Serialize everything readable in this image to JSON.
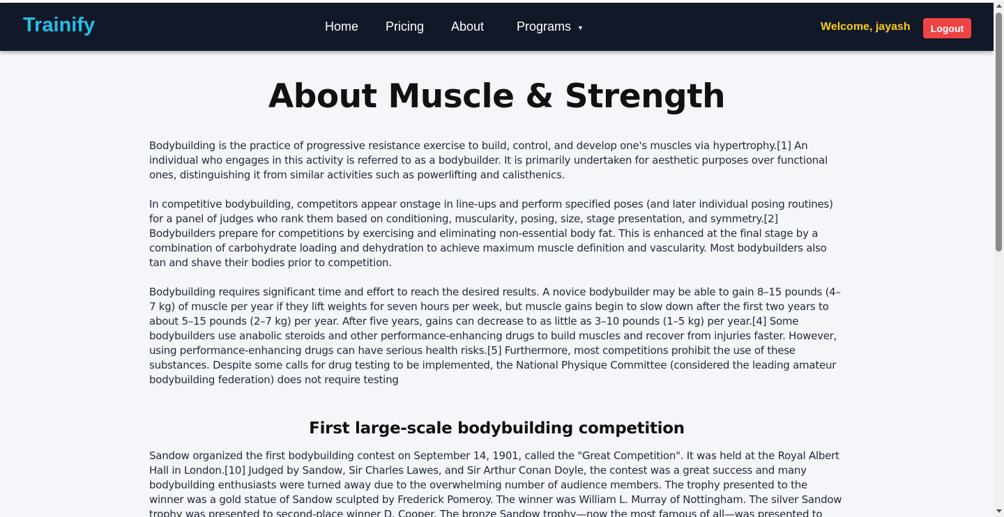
{
  "navbar": {
    "brand": "Trainify",
    "links": {
      "home": "Home",
      "pricing": "Pricing",
      "about": "About",
      "programs": "Programs"
    },
    "welcome": "Welcome, jayash",
    "logout_label": "Logout",
    "colors": {
      "background": "#111827",
      "brand": "#22c0e8",
      "welcome": "#facc15",
      "logout": "#ef4444"
    }
  },
  "page": {
    "title": "About Muscle & Strength",
    "paragraphs": [
      "Bodybuilding is the practice of progressive resistance exercise to build, control, and develop one's muscles via hypertrophy.[1] An individual who engages in this activity is referred to as a bodybuilder. It is primarily undertaken for aesthetic purposes over functional ones, distinguishing it from similar activities such as powerlifting and calisthenics.",
      "In competitive bodybuilding, competitors appear onstage in line-ups and perform specified poses (and later individual posing routines) for a panel of judges who rank them based on conditioning, muscularity, posing, size, stage presentation, and symmetry.[2] Bodybuilders prepare for competitions by exercising and eliminating non-essential body fat. This is enhanced at the final stage by a combination of carbohydrate loading and dehydration to achieve maximum muscle definition and vascularity. Most bodybuilders also tan and shave their bodies prior to competition.",
      "Bodybuilding requires significant time and effort to reach the desired results. A novice bodybuilder may be able to gain 8–15 pounds (4–7 kg) of muscle per year if they lift weights for seven hours per week, but muscle gains begin to slow down after the first two years to about 5–15 pounds (2–7 kg) per year. After five years, gains can decrease to as little as 3–10 pounds (1–5 kg) per year.[4] Some bodybuilders use anabolic steroids and other performance-enhancing drugs to build muscles and recover from injuries faster. However, using performance-enhancing drugs can have serious health risks.[5] Furthermore, most competitions prohibit the use of these substances. Despite some calls for drug testing to be implemented, the National Physique Committee (considered the leading amateur bodybuilding federation) does not require testing"
    ],
    "section_title": "First large-scale bodybuilding competition",
    "section_paragraph": "Sandow organized the first bodybuilding contest on September 14, 1901, called the \"Great Competition\". It was held at the Royal Albert Hall in London.[10] Judged by Sandow, Sir Charles Lawes, and Sir Arthur Conan Doyle, the contest was a great success and many bodybuilding enthusiasts were turned away due to the overwhelming number of audience members. The trophy presented to the winner was a gold statue of Sandow sculpted by Frederick Pomeroy. The winner was William L. Murray of Nottingham. The silver Sandow trophy was presented to second-place winner D. Cooper. The bronze Sandow trophy—now the most famous of all—was presented to third-place winner A.C. Smythe"
  }
}
